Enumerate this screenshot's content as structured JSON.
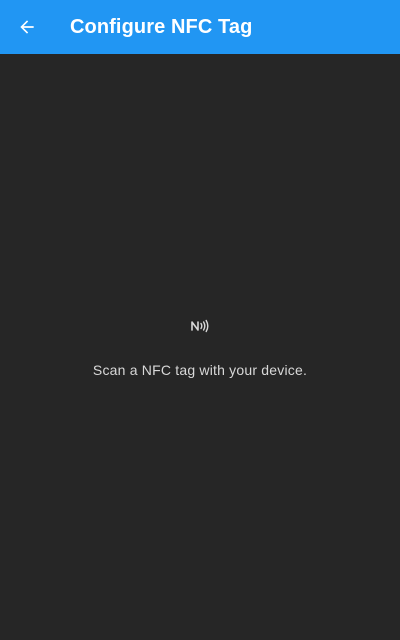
{
  "app_bar": {
    "title": "Configure NFC Tag",
    "background_color": "#2196f3",
    "back_icon": "arrow-back-icon"
  },
  "content": {
    "background_color": "#262626",
    "nfc_icon": "nfc-icon",
    "message": "Scan a NFC tag with your device."
  }
}
